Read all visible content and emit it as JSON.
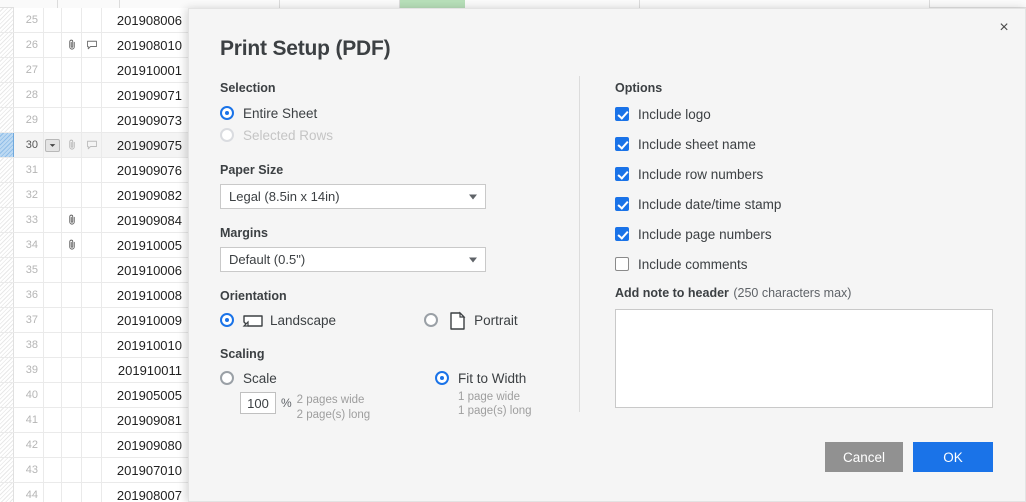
{
  "spreadsheet": {
    "rows": [
      {
        "num": "25",
        "value": "201908006",
        "attachment": false,
        "comment": false,
        "active": false
      },
      {
        "num": "26",
        "value": "201908010",
        "attachment": true,
        "comment": true,
        "active": false
      },
      {
        "num": "27",
        "value": "201910001",
        "attachment": false,
        "comment": false,
        "active": false
      },
      {
        "num": "28",
        "value": "201909071",
        "attachment": false,
        "comment": false,
        "active": false
      },
      {
        "num": "29",
        "value": "201909073",
        "attachment": false,
        "comment": false,
        "active": false
      },
      {
        "num": "30",
        "value": "201909075",
        "attachment": true,
        "comment": true,
        "active": true
      },
      {
        "num": "31",
        "value": "201909076",
        "attachment": false,
        "comment": false,
        "active": false
      },
      {
        "num": "32",
        "value": "201909082",
        "attachment": false,
        "comment": false,
        "active": false
      },
      {
        "num": "33",
        "value": "201909084",
        "attachment": true,
        "comment": false,
        "active": false
      },
      {
        "num": "34",
        "value": "201910005",
        "attachment": true,
        "comment": false,
        "active": false
      },
      {
        "num": "35",
        "value": "201910006",
        "attachment": false,
        "comment": false,
        "active": false
      },
      {
        "num": "36",
        "value": "201910008",
        "attachment": false,
        "comment": false,
        "active": false
      },
      {
        "num": "37",
        "value": "201910009",
        "attachment": false,
        "comment": false,
        "active": false
      },
      {
        "num": "38",
        "value": "201910010",
        "attachment": false,
        "comment": false,
        "active": false
      },
      {
        "num": "39",
        "value": "201910011",
        "attachment": false,
        "comment": false,
        "active": false
      },
      {
        "num": "40",
        "value": "201905005",
        "attachment": false,
        "comment": false,
        "active": false
      },
      {
        "num": "41",
        "value": "201909081",
        "attachment": false,
        "comment": false,
        "active": false
      },
      {
        "num": "42",
        "value": "201909080",
        "attachment": false,
        "comment": false,
        "active": false
      },
      {
        "num": "43",
        "value": "201907010",
        "attachment": false,
        "comment": false,
        "active": false
      },
      {
        "num": "44",
        "value": "201908007",
        "attachment": false,
        "comment": false,
        "active": false
      }
    ],
    "highlight_color": "#b7dfb9"
  },
  "dialog": {
    "title": "Print Setup (PDF)",
    "close_label": "×",
    "selection": {
      "label": "Selection",
      "options": [
        {
          "label": "Entire Sheet",
          "selected": true,
          "disabled": false
        },
        {
          "label": "Selected Rows",
          "selected": false,
          "disabled": true
        }
      ]
    },
    "paper_size": {
      "label": "Paper Size",
      "value": "Legal (8.5in x 14in)"
    },
    "margins": {
      "label": "Margins",
      "value": "Default (0.5\")"
    },
    "orientation": {
      "label": "Orientation",
      "options": [
        {
          "label": "Landscape",
          "selected": true
        },
        {
          "label": "Portrait",
          "selected": false
        }
      ]
    },
    "scaling": {
      "label": "Scaling",
      "scale": {
        "label": "Scale",
        "selected": false,
        "value": "100",
        "percent_symbol": "%",
        "pages_wide": "2 pages wide",
        "pages_long": "2 page(s) long"
      },
      "fit_to_width": {
        "label": "Fit to Width",
        "selected": true,
        "pages_wide": "1 page wide",
        "pages_long": "1 page(s) long"
      }
    },
    "options": {
      "label": "Options",
      "items": [
        {
          "label": "Include logo",
          "checked": true
        },
        {
          "label": "Include sheet name",
          "checked": true
        },
        {
          "label": "Include row numbers",
          "checked": true
        },
        {
          "label": "Include date/time stamp",
          "checked": true
        },
        {
          "label": "Include page numbers",
          "checked": true
        },
        {
          "label": "Include comments",
          "checked": false
        }
      ]
    },
    "note": {
      "label": "Add note to header",
      "hint": "(250 characters max)",
      "value": "",
      "placeholder": ""
    },
    "footer": {
      "cancel_label": "Cancel",
      "ok_label": "OK",
      "cancel_color": "#919191",
      "ok_color": "#1a73e8"
    }
  }
}
